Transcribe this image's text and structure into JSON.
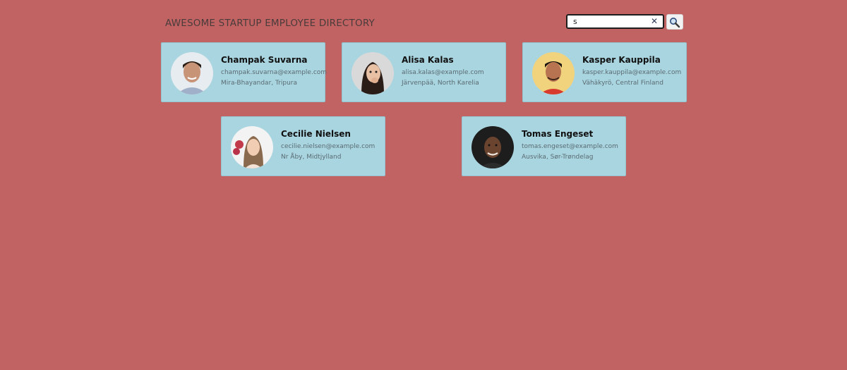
{
  "header": {
    "title": "AWESOME STARTUP EMPLOYEE DIRECTORY"
  },
  "search": {
    "value": "s",
    "clear_icon": "close-icon",
    "button_icon": "magnifier-icon"
  },
  "employees": [
    {
      "name": "Champak Suvarna",
      "email": "champak.suvarna@example.com",
      "location": "Mira-Bhayandar, Tripura"
    },
    {
      "name": "Alisa Kalas",
      "email": "alisa.kalas@example.com",
      "location": "Järvenpää, North Karelia"
    },
    {
      "name": "Kasper Kauppila",
      "email": "kasper.kauppila@example.com",
      "location": "Vähäkyrö, Central Finland"
    },
    {
      "name": "Cecilie Nielsen",
      "email": "cecilie.nielsen@example.com",
      "location": "Nr Åby, Midtjylland"
    },
    {
      "name": "Tomas Engeset",
      "email": "tomas.engeset@example.com",
      "location": "Ausvika, Sør-Trøndelag"
    }
  ],
  "colors": {
    "page_background": "#c26363",
    "card_background": "#a9d5e0"
  }
}
